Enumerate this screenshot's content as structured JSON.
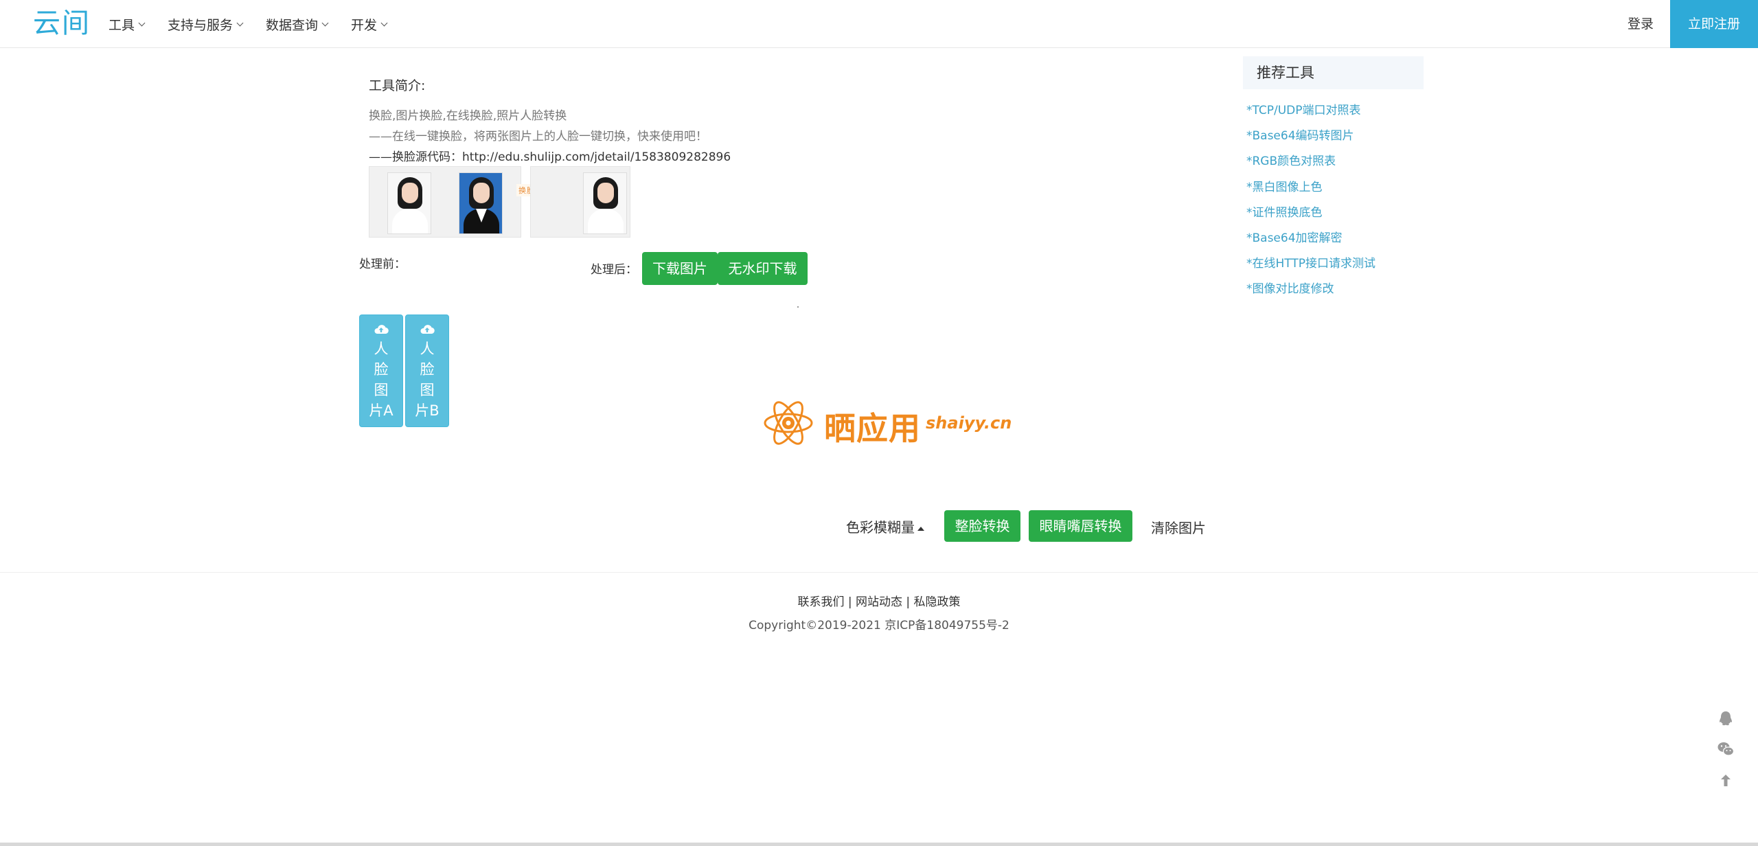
{
  "header": {
    "logo": "云间",
    "nav": [
      "工具",
      "支持与服务",
      "数据查询",
      "开发"
    ],
    "login": "登录",
    "register": "立即注册"
  },
  "intro": {
    "title": "工具简介:",
    "line1": "换脸,图片换脸,在线换脸,照片人脸转换",
    "line2": "——在线一键换脸，将两张图片上的人脸一键切换，快来使用吧！",
    "line3": "——换脸源代码：http://edu.shulijp.com/jdetail/1583809282896",
    "effect_tag": "换脸效果"
  },
  "labels": {
    "before": "处理前：",
    "after": "处理后："
  },
  "buttons": {
    "download": "下载图片",
    "no_watermark": "无水印下载",
    "upload_a": "人脸图片A",
    "upload_b": "人脸图片B",
    "color_blur": "色彩模糊量",
    "face_swap": "整脸转换",
    "eyes_swap": "眼睛嘴唇转换",
    "clear": "清除图片"
  },
  "watermark": {
    "text": "晒应用",
    "url": "shaiyy.cn"
  },
  "sidebar": {
    "title": "推荐工具",
    "items": [
      "*TCP/UDP端口对照表",
      "*Base64编码转图片",
      "*RGB颜色对照表",
      "*黑白图像上色",
      "*证件照换底色",
      "*Base64加密解密",
      "*在线HTTP接口请求测试",
      "*图像对比度修改"
    ]
  },
  "footer": {
    "contact": "联系我们",
    "news": "网站动态",
    "privacy": "私隐政策",
    "separator": "|",
    "copyright": "Copyright©2019-2021 京ICP备18049755号-2"
  },
  "colors": {
    "accent": "#2eaad8",
    "green": "#2aab48",
    "upload": "#5bc0de",
    "link": "#3ba1c8",
    "watermark": "#f08a1f"
  },
  "icons": [
    "chevron-down-icon",
    "cloud-upload-icon",
    "qq-icon",
    "wechat-icon",
    "arrow-up-icon",
    "atom-logo-icon"
  ]
}
